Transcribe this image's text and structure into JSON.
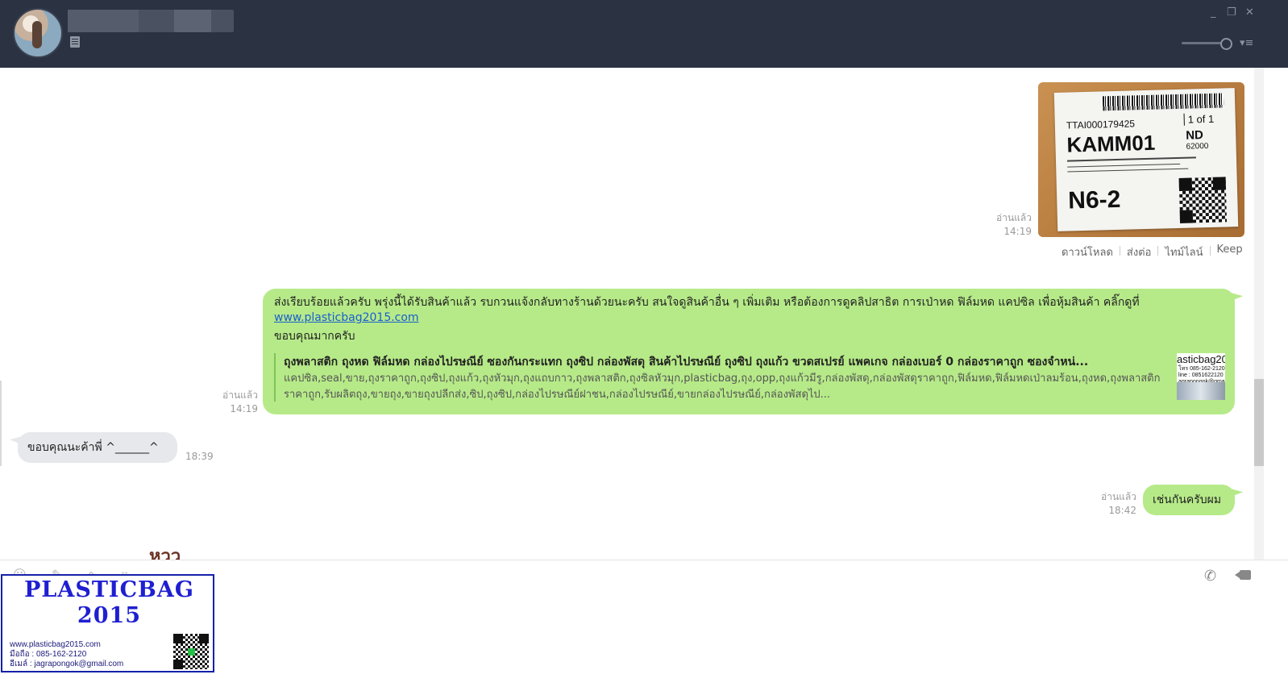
{
  "window": {
    "controls": [
      "_",
      "❐",
      "✕"
    ],
    "menu_icon": "▾≡"
  },
  "messages": {
    "image_msg": {
      "read_label": "อ่านแล้ว",
      "time": "14:19",
      "label_text": {
        "tracking": "TTAI000179425",
        "code": "KAMM01",
        "of": "1 of 1",
        "nd": "ND",
        "zip": "62000",
        "sort": "N6-2"
      },
      "actions": [
        "ดาวน์โหลด",
        "ส่งต่อ",
        "ไทม์ไลน์",
        "Keep"
      ]
    },
    "text_msg": {
      "line1": "ส่งเรียบร้อยแล้วครับ พรุ่งนี้ได้รับสินค้าแล้ว รบกวนแจ้งกลับทางร้านด้วยนะครับ สนใจดูสินค้าอื่น ๆ เพิ่มเติม หรือต้องการดูคลิปสาธิต การเป่าหด ฟิล์มหด แคปซิล เพื่อหุ้มสินค้า คลิ๊กดูที่",
      "link": "www.plasticbag2015.com",
      "line3": "ขอบคุณมากครับ",
      "read_label": "อ่านแล้ว",
      "time": "14:19",
      "preview": {
        "title": "ถุงพลาสติก ถุงหด ฟิล์มหด กล่องไปรษณีย์ ซองกันกระแทก ถุงซิป กล่องพัสดุ สินค้าไปรษณีย์ ถุงซิป ถุงแก้ว ขวดสเปรย์ แพคเกจ กล่องเบอร์ 0 กล่องราคาถูก ซองจำหน่...",
        "desc": "แคปซิล,seal,ขาย,ถุงราคาถูก,ถุงซิป,ถุงแก้ว,ถุงหัวมุก,ถุงแถบกาว,ถุงพลาสติก,ถุงซิลหัวมุก,plasticbag,ถุง,opp,ถุงแก้วมีรู,กล่องพัสดุ,กล่องพัสดุราคาถูก,ฟิล์มหด,ฟิล์มหดเป่าลมร้อน,ถุงหด,ถุงพลาสติกราคาถูก,รับผลิตถุง,ขายถุง,ขายถุงปลีกส่ง,ซิป,ถุงซิป,กล่องไปรษณีย์ฝาชน,กล่องไปรษณีย์,ขายกล่องไปรษณีย์,กล่องพัสดุไป...",
        "thumb_title": "asticbag20",
        "thumb_lines": "โทร 085-162-2120\nline : 0851622120\nagrapongok@gmail.com"
      }
    },
    "incoming_msg": {
      "text": "ขอบคุณนะค้าพี่ ^______^",
      "time": "18:39"
    },
    "reply_msg": {
      "text": "เช่นกันครับผม",
      "read_label": "อ่านแล้ว",
      "time": "18:42"
    },
    "sticker_peek": "หวว"
  },
  "watermark": {
    "title": "PLASTICBAG\n2015",
    "website": "www.plasticbag2015.com",
    "phone": "มือถือ : 085-162-2120",
    "email": "อีเมล์ : jagrapongok@gmail.com"
  },
  "input_bar": {
    "call_icon": "✆"
  },
  "colors": {
    "header_bg": "#2b3241",
    "bubble_green": "#b6ea88",
    "bubble_grey": "#e6e8eb",
    "link": "#1a5fcf",
    "watermark_blue": "#1f1fd1"
  },
  "icons": [
    "note-icon",
    "minimize-icon",
    "restore-icon",
    "close-icon",
    "zoom-slider",
    "menu-icon",
    "emoji-icon",
    "attach-icon",
    "gift-icon",
    "screenshot-icon",
    "call-icon",
    "video-icon"
  ]
}
